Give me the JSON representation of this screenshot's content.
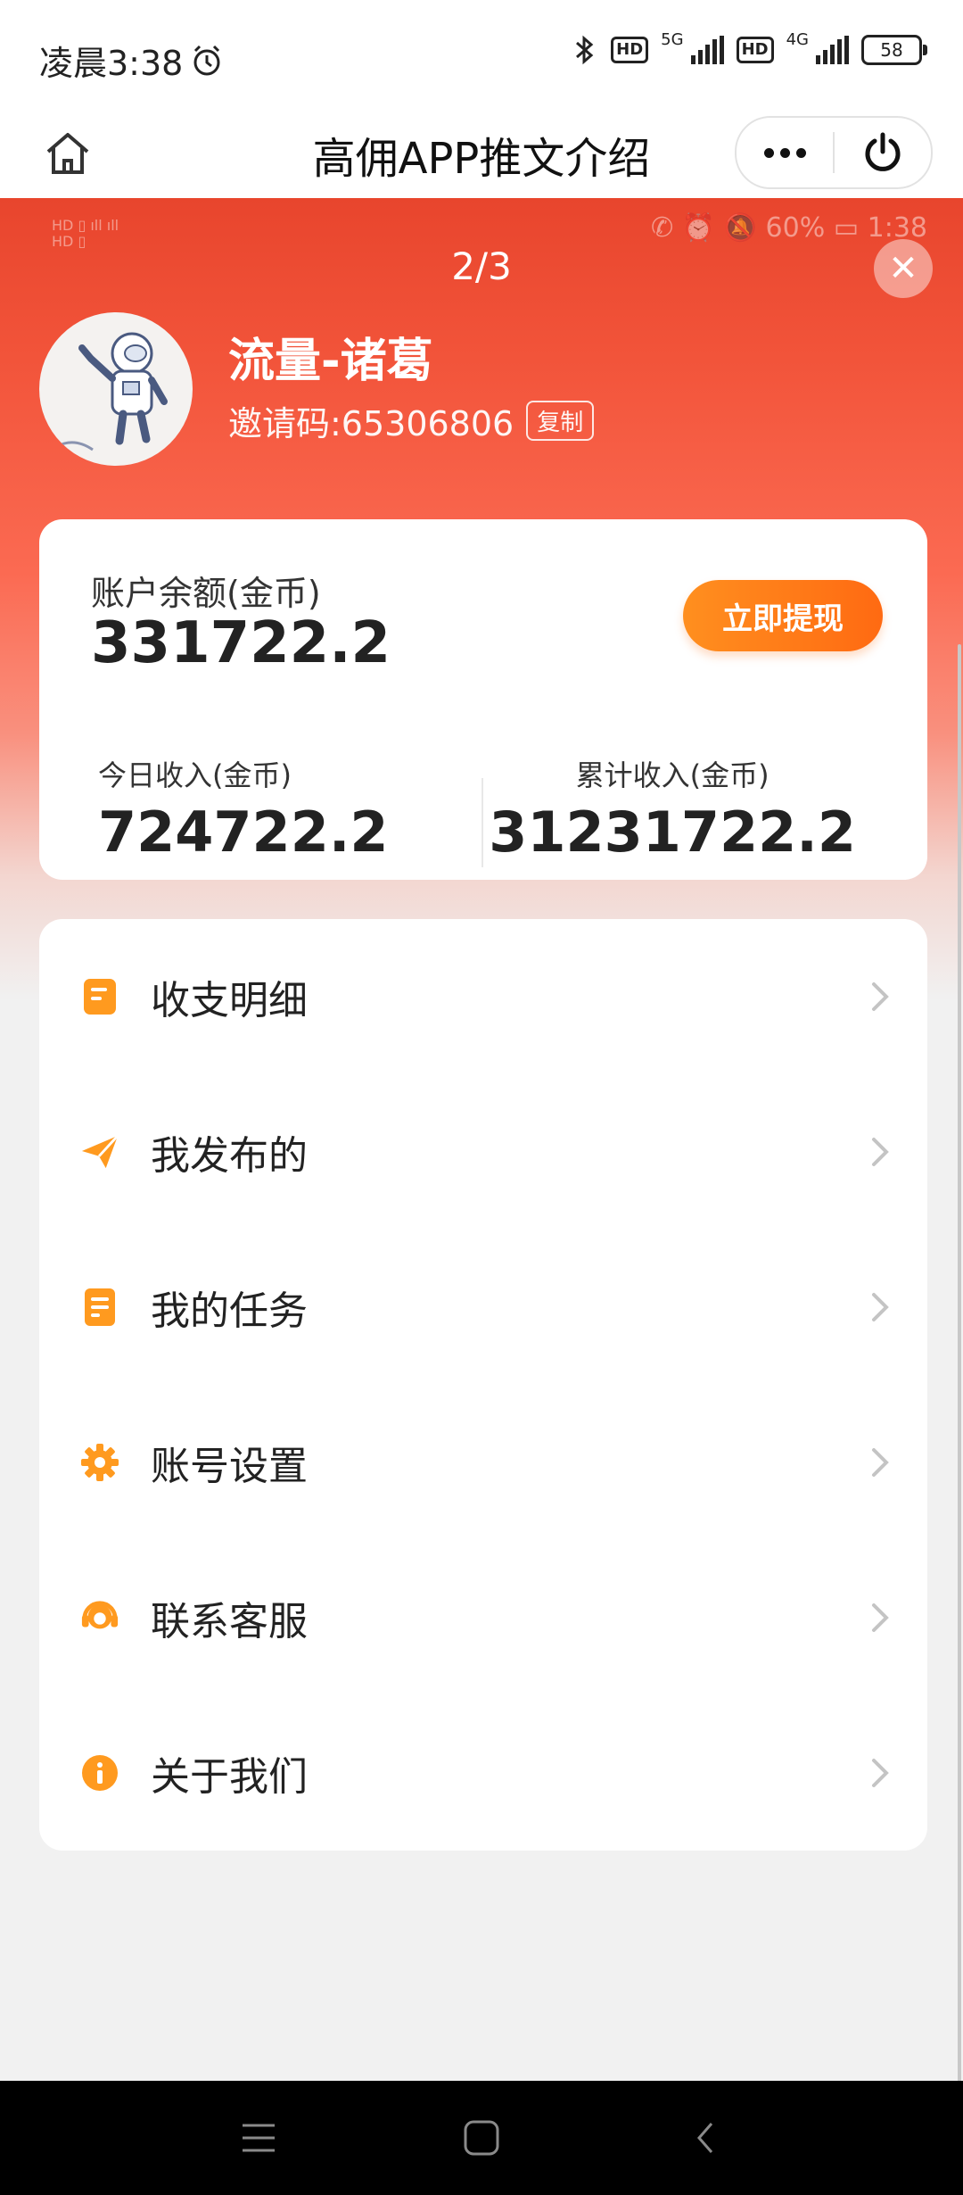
{
  "status_bar": {
    "time": "凌晨3:38",
    "network_5g": "5G",
    "network_4g": "4G",
    "hd": "HD",
    "battery": "58"
  },
  "nav": {
    "title": "高佣APP推文介绍"
  },
  "viewer": {
    "counter": "2/3",
    "ghost_status_right": "60%",
    "ghost_time": "1:38"
  },
  "profile": {
    "username": "流量-诸葛",
    "invite_code": "邀请码:65306806",
    "copy_label": "复制"
  },
  "balance": {
    "label": "账户余额(金币)",
    "value": "331722.2",
    "withdraw_label": "立即提现",
    "today_label": "今日收入(金币)",
    "today_value": "724722.2",
    "total_label": "累计收入(金币)",
    "total_value": "31231722.2"
  },
  "menu": {
    "items": [
      {
        "label": "收支明细",
        "icon": "document-icon"
      },
      {
        "label": "我发布的",
        "icon": "paper-plane-icon"
      },
      {
        "label": "我的任务",
        "icon": "task-list-icon"
      },
      {
        "label": "账号设置",
        "icon": "gear-icon"
      },
      {
        "label": "联系客服",
        "icon": "headset-icon"
      },
      {
        "label": "关于我们",
        "icon": "info-icon"
      }
    ]
  },
  "colors": {
    "accent_orange": "#ff8a1f",
    "header_red": "#f2543a"
  }
}
